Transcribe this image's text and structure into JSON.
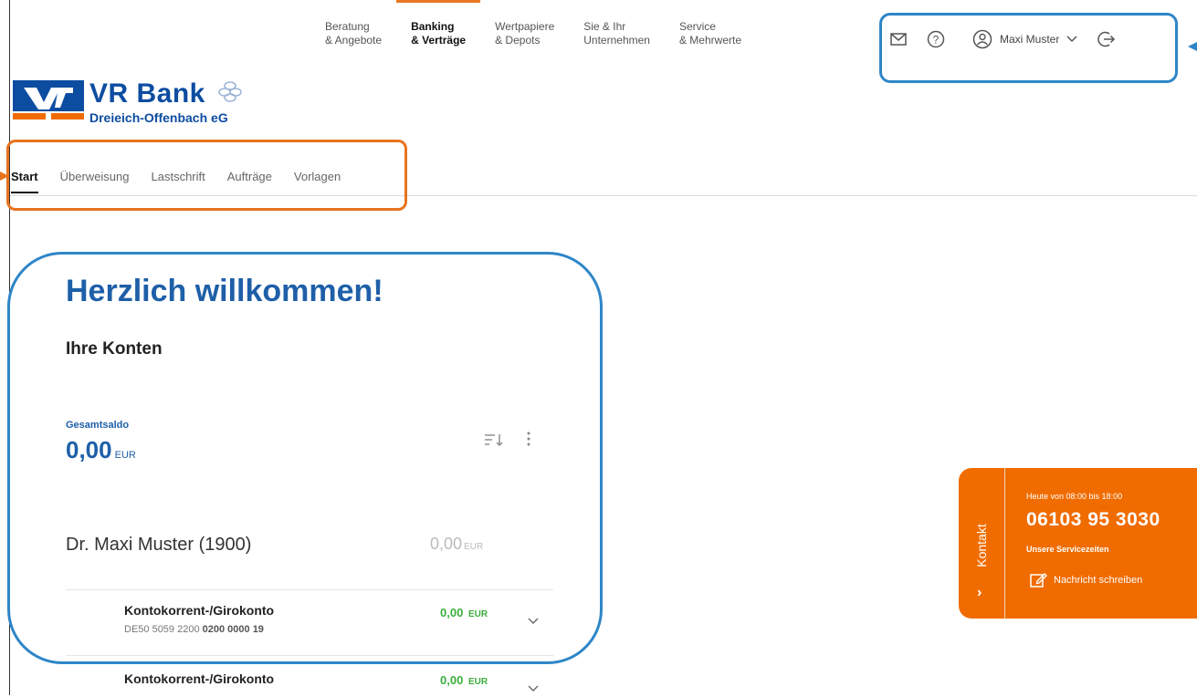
{
  "topnav": {
    "items": [
      {
        "line1": "Beratung",
        "line2": "& Angebote"
      },
      {
        "line1": "Banking",
        "line2": "& Verträge"
      },
      {
        "line1": "Wertpapiere",
        "line2": "& Depots"
      },
      {
        "line1": "Sie & Ihr",
        "line2": "Unternehmen"
      },
      {
        "line1": "Service",
        "line2": "& Mehrwerte"
      }
    ],
    "active_index": 1
  },
  "toolbar": {
    "mail_icon": "envelope-icon",
    "help_icon": "question-circle-icon",
    "user_icon": "user-circle-icon",
    "user_name": "Maxi Muster",
    "logout_icon": "logout-icon"
  },
  "logo": {
    "title": "VR Bank",
    "subtitle": "Dreieich-Offenbach eG"
  },
  "subnav": {
    "items": [
      "Start",
      "Überweisung",
      "Lastschrift",
      "Aufträge",
      "Vorlagen"
    ],
    "active_index": 0
  },
  "main": {
    "welcome": "Herzlich willkommen!",
    "section_title": "Ihre Konten",
    "total_label": "Gesamtsaldo",
    "total_value": "0,00",
    "total_currency": "EUR",
    "holder_name": "Dr. Maxi Muster (1900)",
    "holder_value": "0,00",
    "holder_currency": "EUR",
    "accounts": [
      {
        "name": "Kontokorrent-/Girokonto",
        "iban_prefix": "DE50 5059 2200",
        "iban_suffix": "0200 0000 19",
        "value": "0,00",
        "currency": "EUR"
      },
      {
        "name": "Kontokorrent-/Girokonto",
        "iban_prefix": "",
        "iban_suffix": "",
        "value": "0,00",
        "currency": "EUR"
      }
    ]
  },
  "contact": {
    "tab_label": "Kontakt",
    "hours": "Heute von 08:00 bis 18:00",
    "phone": "06103 95 3030",
    "service_link": "Unsere Servicezeiten",
    "message_label": "Nachricht schreiben"
  },
  "colors": {
    "brand_blue": "#0d4da1",
    "heading_blue": "#1e5fa8",
    "accent_orange": "#f06c00",
    "positive_green": "#3cae3c",
    "highlight_blue": "#2e86c8",
    "highlight_orange": "#e8731e"
  }
}
